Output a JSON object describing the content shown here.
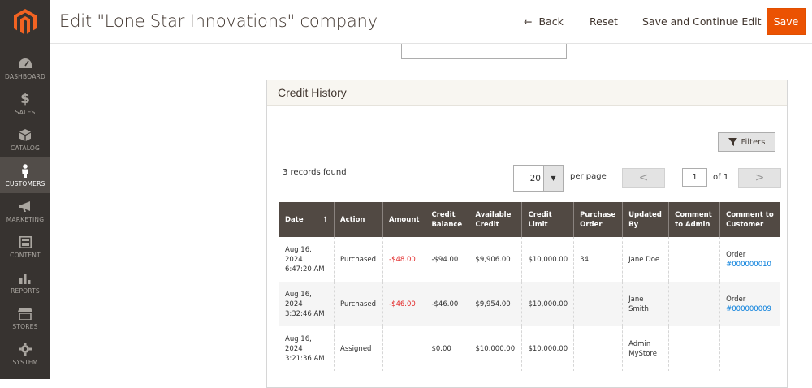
{
  "sidebar": {
    "items": [
      {
        "label": "DASHBOARD",
        "icon": "dashboard-icon"
      },
      {
        "label": "SALES",
        "icon": "dollar-icon"
      },
      {
        "label": "CATALOG",
        "icon": "cube-icon"
      },
      {
        "label": "CUSTOMERS",
        "icon": "person-icon",
        "active": true
      },
      {
        "label": "MARKETING",
        "icon": "megaphone-icon"
      },
      {
        "label": "CONTENT",
        "icon": "layout-icon"
      },
      {
        "label": "REPORTS",
        "icon": "bar-chart-icon"
      },
      {
        "label": "STORES",
        "icon": "storefront-icon"
      },
      {
        "label": "SYSTEM",
        "icon": "gear-icon"
      }
    ]
  },
  "header": {
    "title": "Edit \"Lone Star Innovations\" company",
    "back_label": "Back",
    "back_arrow": "←",
    "reset_label": "Reset",
    "save_continue_label": "Save and Continue Edit",
    "save_label": "Save"
  },
  "colors": {
    "accent": "#eb5202",
    "sidebar": "#373330",
    "table_header": "#514943",
    "link": "#007bdb",
    "negative": "#e22626"
  },
  "credit_history": {
    "title": "Credit History",
    "filters_label": "Filters",
    "records_found": "3 records found",
    "per_page_value": "20",
    "per_page_label": "per page",
    "page_value": "1",
    "page_of": "of 1",
    "prev_glyph": "<",
    "next_glyph": ">",
    "columns": [
      "Date",
      "Action",
      "Amount",
      "Credit Balance",
      "Available Credit",
      "Credit Limit",
      "Purchase Order",
      "Updated By",
      "Comment to Admin",
      "Comment to Customer"
    ],
    "sort_arrow": "↑",
    "rows": [
      {
        "date": "Aug 16, 2024 6:47:20 AM",
        "action": "Purchased",
        "amount": "-$48.00",
        "credit_balance": "-$94.00",
        "available_credit": "$9,906.00",
        "credit_limit": "$10,000.00",
        "purchase_order": "34",
        "updated_by": "Jane Doe",
        "comment_admin": "",
        "comment_customer_text": "Order",
        "comment_customer_link": "#000000010"
      },
      {
        "date": "Aug 16, 2024 3:32:46 AM",
        "action": "Purchased",
        "amount": "-$46.00",
        "credit_balance": "-$46.00",
        "available_credit": "$9,954.00",
        "credit_limit": "$10,000.00",
        "purchase_order": "",
        "updated_by": "Jane Smith",
        "comment_admin": "",
        "comment_customer_text": "Order",
        "comment_customer_link": "#000000009"
      },
      {
        "date": "Aug 16, 2024 3:21:36 AM",
        "action": "Assigned",
        "amount": "",
        "credit_balance": "$0.00",
        "available_credit": "$10,000.00",
        "credit_limit": "$10,000.00",
        "purchase_order": "",
        "updated_by": "Admin MyStore",
        "comment_admin": "",
        "comment_customer_text": "",
        "comment_customer_link": ""
      }
    ]
  }
}
